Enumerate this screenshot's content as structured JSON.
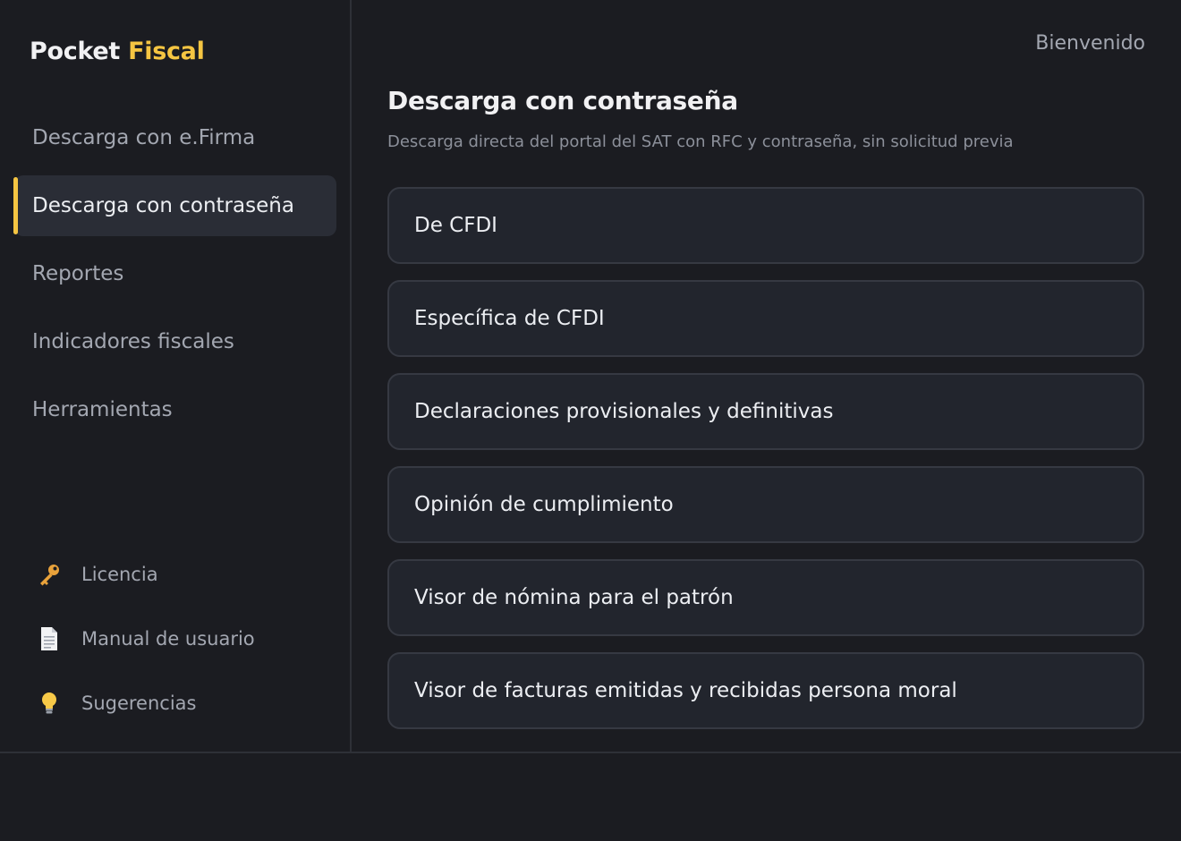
{
  "brand": {
    "part1": "Pocket",
    "part2": "Fiscal",
    "accent_color": "#f5c542"
  },
  "sidebar": {
    "items": [
      {
        "label": "Descarga con e.Firma",
        "active": false
      },
      {
        "label": "Descarga con contraseña",
        "active": true
      },
      {
        "label": "Reportes",
        "active": false
      },
      {
        "label": "Indicadores fiscales",
        "active": false
      },
      {
        "label": "Herramientas",
        "active": false
      }
    ],
    "bottom_links": [
      {
        "label": "Licencia",
        "icon": "key-icon"
      },
      {
        "label": "Manual de usuario",
        "icon": "document-icon"
      },
      {
        "label": "Sugerencias",
        "icon": "lightbulb-icon"
      }
    ]
  },
  "header": {
    "welcome": "Bienvenido"
  },
  "main": {
    "title": "Descarga con contraseña",
    "subtitle": "Descarga directa del portal del SAT con RFC y contraseña, sin solicitud previa",
    "options": [
      "De CFDI",
      "Específica de CFDI",
      "Declaraciones provisionales y definitivas",
      "Opinión de cumplimiento",
      "Visor de nómina para el patrón",
      "Visor de facturas emitidas y recibidas persona moral"
    ]
  }
}
